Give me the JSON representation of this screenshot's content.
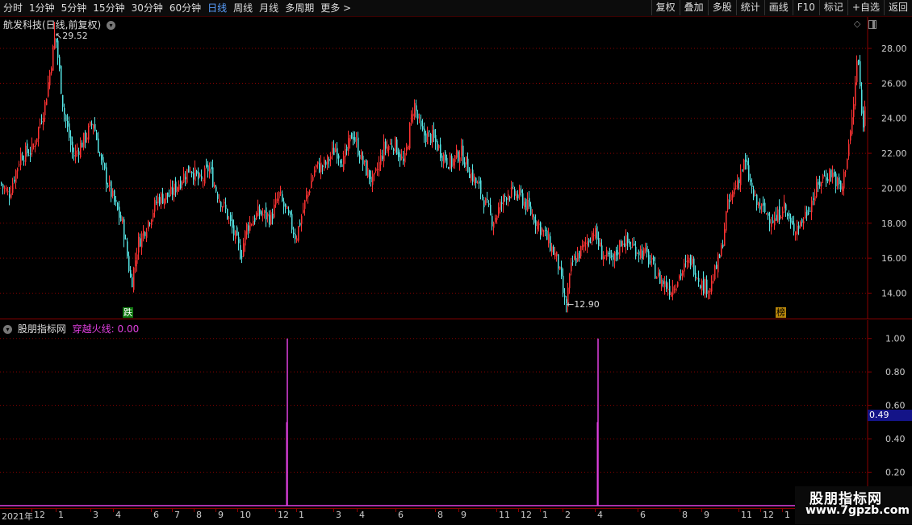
{
  "toolbar": {
    "periods": [
      "分时",
      "1分钟",
      "5分钟",
      "15分钟",
      "30分钟",
      "60分钟",
      "日线",
      "周线",
      "月线",
      "多周期",
      "更多 >"
    ],
    "active_period": "日线",
    "buttons": [
      "复权",
      "叠加",
      "多股",
      "统计",
      "画线",
      "F10",
      "标记",
      "+自选",
      "返回"
    ]
  },
  "main": {
    "title": "航发科技(日线,前复权)",
    "high_note": "29.52",
    "low_note": "12.90",
    "markers": {
      "die": "跌",
      "bang": "榜"
    }
  },
  "indicator": {
    "name": "股朋指标网",
    "line_label": "穿越火线: 0.00",
    "current_value": "0.49"
  },
  "colors": {
    "up": "#ff3333",
    "down": "#55e5e5",
    "grid": "#8a0000",
    "indicator": "#e040e0"
  },
  "chart_data": [
    {
      "type": "candlestick",
      "title": "航发科技(日线,前复权)",
      "ylim": [
        12.5,
        29.8
      ],
      "y_ticks": [
        "14.00",
        "16.00",
        "18.00",
        "20.00",
        "22.00",
        "24.00",
        "26.00",
        "28.00"
      ],
      "n_days": 540,
      "high": {
        "value": 29.52,
        "day": 67
      },
      "low": {
        "value": 12.9,
        "day": 702
      },
      "close_path": [
        [
          0,
          20.3
        ],
        [
          10,
          19.6
        ],
        [
          25,
          21.9
        ],
        [
          40,
          22.2
        ],
        [
          55,
          24.8
        ],
        [
          68,
          28.8
        ],
        [
          78,
          24.5
        ],
        [
          90,
          21.8
        ],
        [
          105,
          22.9
        ],
        [
          115,
          23.8
        ],
        [
          125,
          21.4
        ],
        [
          140,
          19.3
        ],
        [
          152,
          17.8
        ],
        [
          162,
          14.5
        ],
        [
          170,
          16.8
        ],
        [
          180,
          17.8
        ],
        [
          195,
          19.4
        ],
        [
          210,
          19.6
        ],
        [
          225,
          20.6
        ],
        [
          235,
          21.2
        ],
        [
          248,
          20.3
        ],
        [
          258,
          21.2
        ],
        [
          268,
          19.8
        ],
        [
          280,
          18.6
        ],
        [
          298,
          16.2
        ],
        [
          305,
          17.8
        ],
        [
          320,
          18.6
        ],
        [
          335,
          18.3
        ],
        [
          345,
          19.6
        ],
        [
          358,
          18.2
        ],
        [
          366,
          17.2
        ],
        [
          378,
          19.3
        ],
        [
          390,
          21.2
        ],
        [
          402,
          21.3
        ],
        [
          415,
          22.3
        ],
        [
          425,
          21.5
        ],
        [
          436,
          23.2
        ],
        [
          450,
          21.3
        ],
        [
          462,
          20.3
        ],
        [
          475,
          22.3
        ],
        [
          488,
          22.6
        ],
        [
          500,
          21.3
        ],
        [
          512,
          24.9
        ],
        [
          522,
          23.1
        ],
        [
          535,
          22.9
        ],
        [
          548,
          21.9
        ],
        [
          558,
          21.4
        ],
        [
          570,
          22.1
        ],
        [
          582,
          20.9
        ],
        [
          595,
          19.8
        ],
        [
          610,
          18.1
        ],
        [
          628,
          19.8
        ],
        [
          645,
          19.5
        ],
        [
          660,
          18.4
        ],
        [
          675,
          17.3
        ],
        [
          690,
          15.9
        ],
        [
          700,
          13.2
        ],
        [
          708,
          15.7
        ],
        [
          722,
          16.6
        ],
        [
          735,
          17.6
        ],
        [
          745,
          16.3
        ],
        [
          758,
          15.7
        ],
        [
          770,
          17.1
        ],
        [
          785,
          16.6
        ],
        [
          800,
          16.2
        ],
        [
          815,
          14.9
        ],
        [
          830,
          14.2
        ],
        [
          845,
          15.3
        ],
        [
          855,
          15.9
        ],
        [
          870,
          14.4
        ],
        [
          880,
          14.4
        ],
        [
          893,
          16.4
        ],
        [
          900,
          18.8
        ],
        [
          910,
          20.1
        ],
        [
          922,
          21.5
        ],
        [
          935,
          19.2
        ],
        [
          948,
          18.6
        ],
        [
          960,
          18.1
        ],
        [
          970,
          19.1
        ],
        [
          980,
          17.7
        ],
        [
          992,
          18.0
        ],
        [
          1005,
          19.3
        ],
        [
          1018,
          20.6
        ],
        [
          1030,
          20.9
        ],
        [
          1042,
          19.8
        ],
        [
          1050,
          22.2
        ],
        [
          1056,
          24.2
        ],
        [
          1062,
          27.8
        ],
        [
          1068,
          23.5
        ],
        [
          1075,
          25.8
        ]
      ],
      "x_ticks": [
        "2021年",
        "12",
        "1",
        "3",
        "4",
        "6",
        "7",
        "8",
        "9",
        "10",
        "12",
        "1",
        "3",
        "4",
        "6",
        "8",
        "9",
        "11",
        "12",
        "1",
        "2",
        "4",
        "6",
        "8",
        "9",
        "11",
        "12",
        "1"
      ]
    },
    {
      "type": "bar",
      "series": [
        {
          "name": "穿越火线",
          "values": [
            {
              "day": 176,
              "value": 1.0
            },
            {
              "day": 191,
              "value": 0.5
            },
            {
              "day": 370,
              "value": 1.0
            },
            {
              "day": 385,
              "value": 0.5
            }
          ]
        }
      ],
      "ylim": [
        0.0,
        1.1
      ],
      "y_ticks": [
        "0.20",
        "0.40",
        "0.60",
        "0.80",
        "1.00"
      ]
    }
  ]
}
